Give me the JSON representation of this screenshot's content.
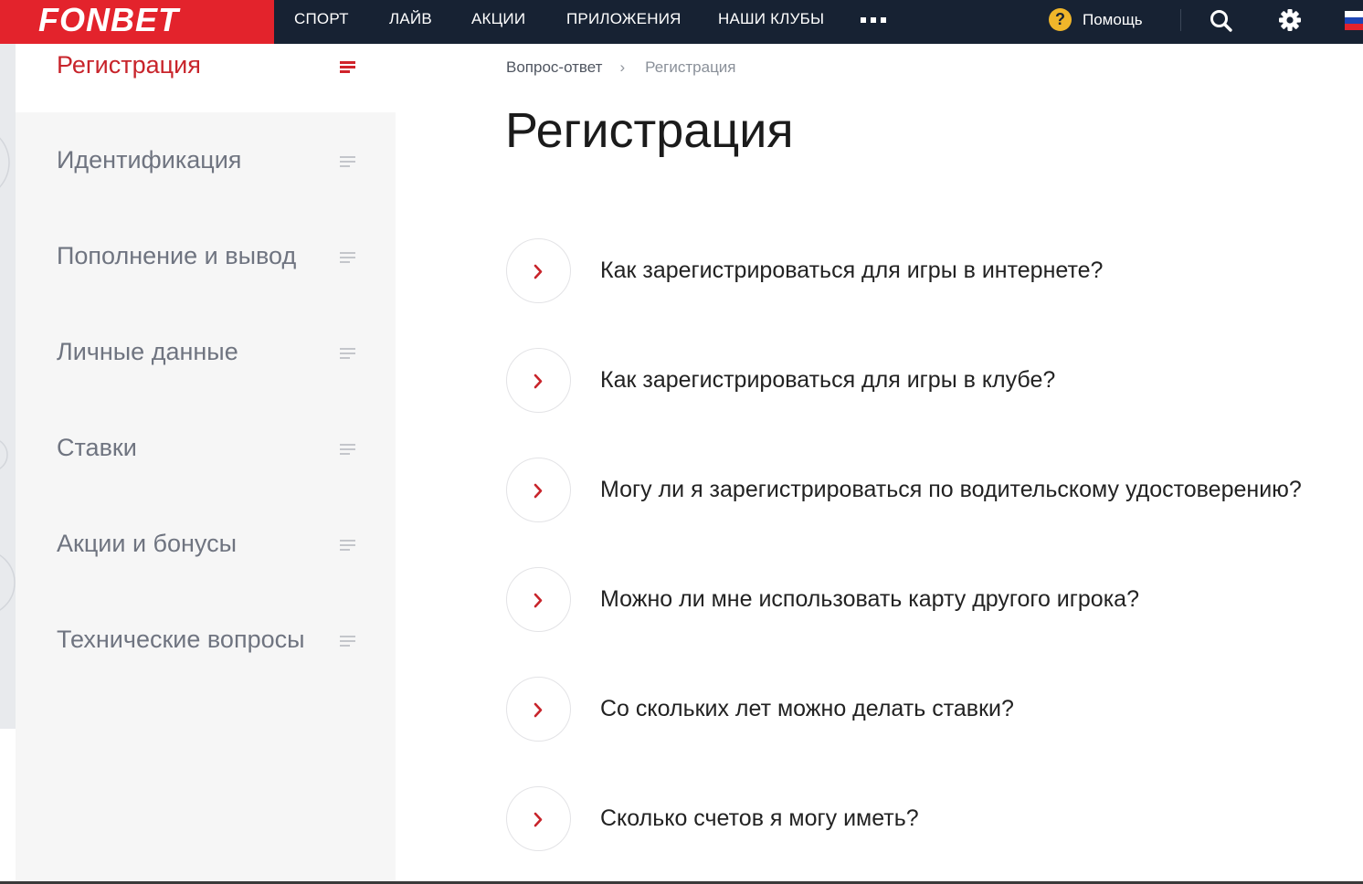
{
  "brand": {
    "name": "FONBET",
    "color": "#e3232c"
  },
  "colors": {
    "nav_bg": "#172233",
    "accent": "#c8242b",
    "help_icon": "#f0b62a",
    "sidebar_bg": "#f6f6f6"
  },
  "nav": {
    "items": [
      "Спорт",
      "Лайв",
      "Акции",
      "Приложения",
      "Наши клубы"
    ],
    "more_icon": "more-dots-icon",
    "help_label": "Помощь",
    "help_icon": "question-circle-icon",
    "search_icon": "search-icon",
    "settings_icon": "gear-icon",
    "flag_icon": "russia-flag-icon"
  },
  "sidebar": {
    "items": [
      {
        "label": "Регистрация",
        "active": true
      },
      {
        "label": "Идентификация",
        "active": false
      },
      {
        "label": "Пополнение и вывод",
        "active": false
      },
      {
        "label": "Личные данные",
        "active": false
      },
      {
        "label": "Ставки",
        "active": false
      },
      {
        "label": "Акции и бонусы",
        "active": false
      },
      {
        "label": "Технические вопросы",
        "active": false
      }
    ],
    "item_icon": "list-lines-icon"
  },
  "breadcrumb": {
    "root": "Вопрос-ответ",
    "separator": "›",
    "current": "Регистрация"
  },
  "main": {
    "title": "Регистрация",
    "faq_icon": "chevron-right-icon",
    "questions": [
      "Как зарегистрироваться для игры в интернете?",
      "Как зарегистрироваться для игры в клубе?",
      "Могу ли я зарегистрироваться по водительскому удостоверению?",
      "Можно ли мне использовать карту другого игрока?",
      "Со скольких лет можно делать ставки?",
      "Сколько счетов я могу иметь?"
    ]
  }
}
